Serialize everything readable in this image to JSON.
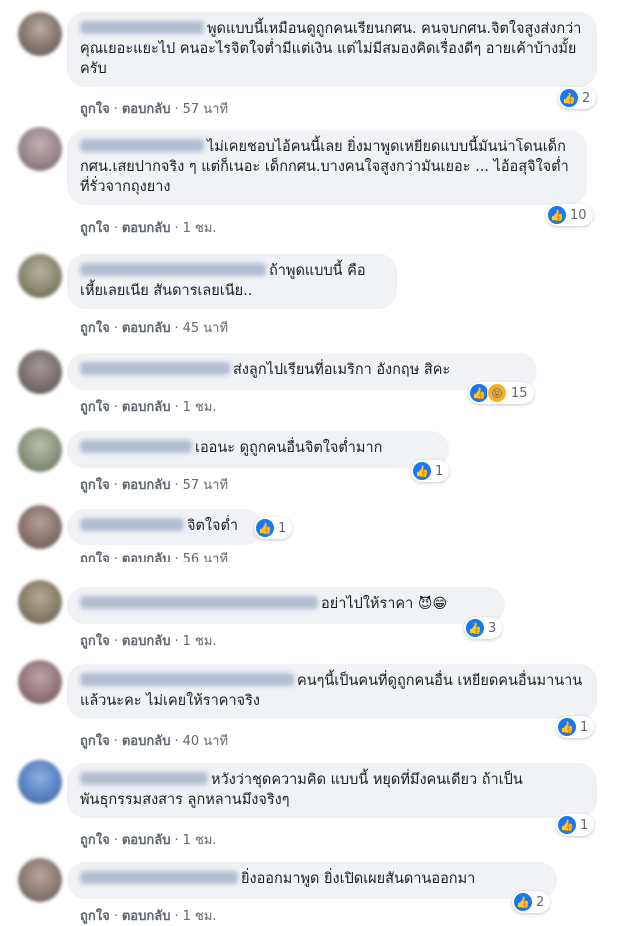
{
  "labels": {
    "like": "ถูกใจ",
    "reply": "ตอบกลับ",
    "sep": "·"
  },
  "comments": [
    {
      "text": "พูดแบบนี้เหมือนดูถูกคนเรียนกศน. คนจบกศน.จิตใจสูงส่งกว่าคุณเยอะแยะไป คนอะไรจิตใจต่ำมีแต่เงิน แต่ไม่มีสมองคิดเรื่องดีๆ อายเค้าบ้างมั้ยครับ",
      "time": "57 นาที",
      "reactions": "2"
    },
    {
      "text": "ไม่เคยชอบไอ้คนนี้เลย ยิ่งมาพูดเหยียดแบบนี้มันน่าโดนเด็กกศน.เสยปากจริง ๆ แต่ก็เนอะ เด็กกศน.บางคนใจสูงกว่ามันเยอะ ... ไอ้อสุจิใจต่ำที่รั่วจากถุงยาง",
      "time": "1 ชม.",
      "reactions": "10"
    },
    {
      "text": "ถ้าพูดแบบนี้ คือเหี้ยเลยเนีย สันดารเลยเนีย..",
      "time": "45 นาที",
      "reactions": ""
    },
    {
      "text": "ส่งลูกไปเรียนที่อเมริกา อังกฤษ สิคะ",
      "time": "1 ชม.",
      "reactions": "15"
    },
    {
      "text": "เออนะ ดูถูกคนอื่นจิตใจต่ำมาก",
      "time": "57 นาที",
      "reactions": "1"
    },
    {
      "text": "จิตใจต่ำ",
      "time": "56 นาที",
      "reactions": "1"
    },
    {
      "text": "อย่าไปให้ราคา",
      "emoji": "😈😁",
      "time": "1 ชม.",
      "reactions": "3"
    },
    {
      "text": "คนๆนี้เป็นคนที่ดูถูกคนอื่น เหยียดคนอื่นมานานแล้วนะคะ ไม่เคยให้ราคาจริง",
      "time": "40 นาที",
      "reactions": "1"
    },
    {
      "text": "หวังว่าชุดความคิด แบบนี้ หยุดที่มึงคนเดียว ถ้าเป็นพันธุกรรมสงสาร ลูกหลานมึงจริงๆ",
      "time": "1 ชม.",
      "reactions": "1"
    },
    {
      "text": "ยิ่งออกมาพูด ยิ่งเปิดเผยสันดานออกมา",
      "time": "1 ชม.",
      "reactions": "2"
    }
  ]
}
